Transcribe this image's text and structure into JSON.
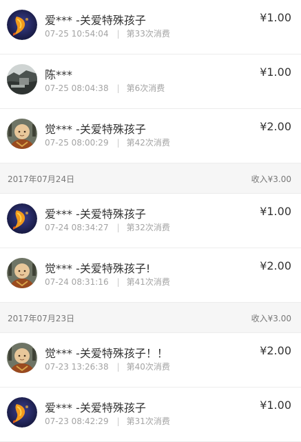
{
  "separator": "|",
  "feed": [
    {
      "kind": "tx",
      "avatar": "koi-fish-avatar",
      "name": "爱*** -关爱特殊孩子",
      "time": "07-25 10:54:04",
      "count": "第33次消费",
      "amount": "¥1.00"
    },
    {
      "kind": "tx",
      "avatar": "landscape-photo-avatar",
      "name": "陈***",
      "time": "07-25 08:04:38",
      "count": "第6次消费",
      "amount": "¥1.00"
    },
    {
      "kind": "tx",
      "avatar": "monk-avatar",
      "name": "觉*** -关爱特殊孩子",
      "time": "07-25 08:00:29",
      "count": "第42次消费",
      "amount": "¥2.00"
    },
    {
      "kind": "date",
      "date": "2017年07月24日",
      "income": "收入¥3.00"
    },
    {
      "kind": "tx",
      "avatar": "koi-fish-avatar",
      "name": "爱*** -关爱特殊孩子",
      "time": "07-24 08:34:27",
      "count": "第32次消费",
      "amount": "¥1.00"
    },
    {
      "kind": "tx",
      "avatar": "monk-avatar",
      "name": "觉*** -关爱特殊孩子!",
      "time": "07-24 08:31:16",
      "count": "第41次消费",
      "amount": "¥2.00"
    },
    {
      "kind": "date",
      "date": "2017年07月23日",
      "income": "收入¥3.00"
    },
    {
      "kind": "tx",
      "avatar": "monk-avatar",
      "name": "觉*** -关爱特殊孩子！！",
      "time": "07-23 13:26:38",
      "count": "第40次消费",
      "amount": "¥2.00"
    },
    {
      "kind": "tx",
      "avatar": "koi-fish-avatar",
      "name": "爱*** -关爱特殊孩子",
      "time": "07-23 08:42:29",
      "count": "第31次消费",
      "amount": "¥1.00"
    }
  ]
}
